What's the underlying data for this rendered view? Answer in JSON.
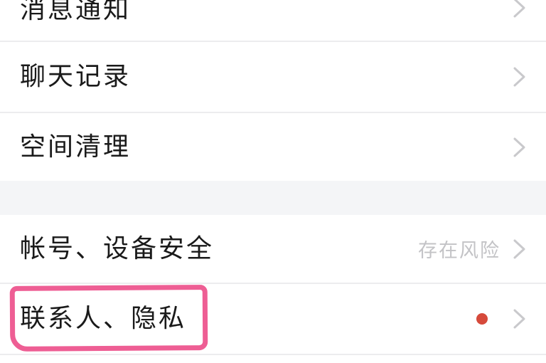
{
  "settings": {
    "group1": [
      {
        "label": "消息通知"
      },
      {
        "label": "聊天记录"
      },
      {
        "label": "空间清理"
      }
    ],
    "group2": [
      {
        "label": "帐号、设备安全",
        "status": "存在风险"
      },
      {
        "label": "联系人、隐私",
        "badge": "red-dot"
      }
    ]
  },
  "colors": {
    "red_dot": "#d64a3b",
    "highlight": "#ee5e94",
    "status_text": "#c3c3c6",
    "section_gap": "#f4f5f7"
  },
  "icons": {
    "chevron": "chevron-right-icon"
  }
}
